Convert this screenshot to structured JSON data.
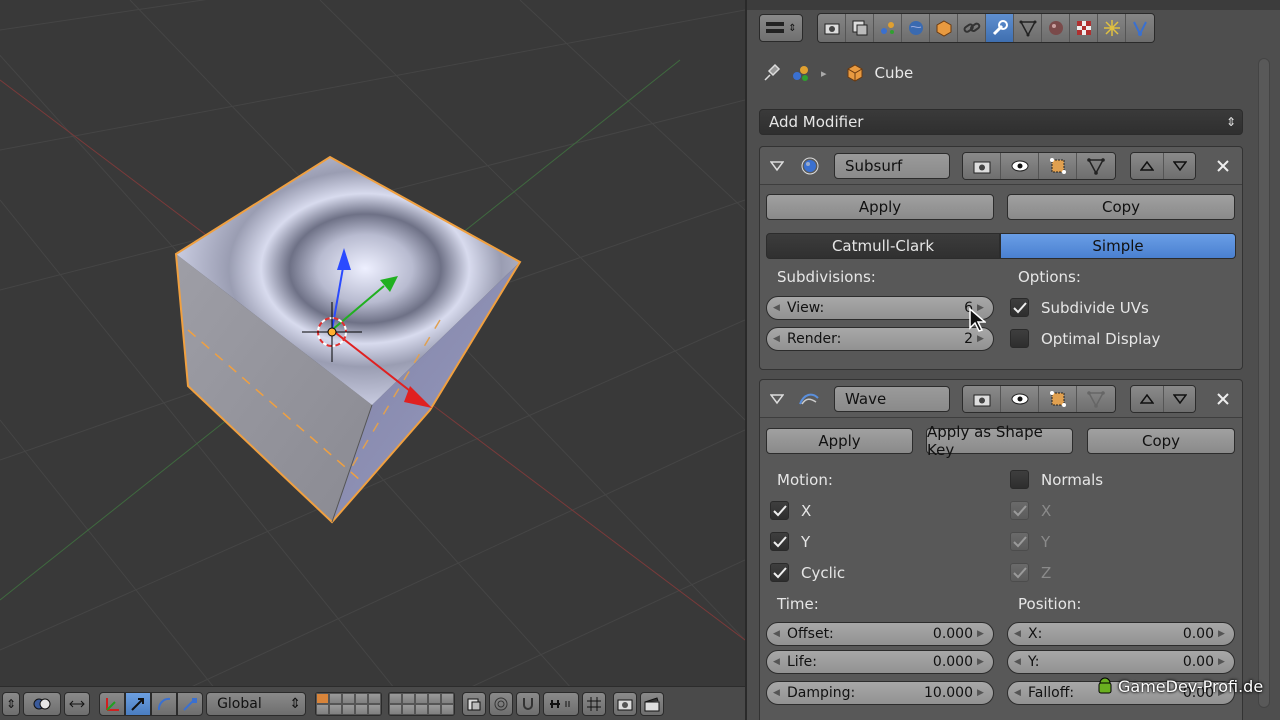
{
  "viewport": {
    "header": {
      "orientation": "Global"
    }
  },
  "properties": {
    "breadcrumb": {
      "object_name": "Cube"
    },
    "add_modifier_label": "Add Modifier",
    "subsurf": {
      "name": "Subsurf",
      "apply_label": "Apply",
      "copy_label": "Copy",
      "algorithm_options": [
        "Catmull-Clark",
        "Simple"
      ],
      "algorithm_selected": "Simple",
      "subdivisions_label": "Subdivisions:",
      "view_label": "View:",
      "view_value": "6",
      "render_label": "Render:",
      "render_value": "2",
      "options_label": "Options:",
      "subdivide_uvs_label": "Subdivide UVs",
      "subdivide_uvs_checked": true,
      "optimal_display_label": "Optimal Display",
      "optimal_display_checked": false
    },
    "wave": {
      "name": "Wave",
      "apply_label": "Apply",
      "apply_shape_label": "Apply as Shape Key",
      "copy_label": "Copy",
      "motion_label": "Motion:",
      "x_label": "X",
      "y_label": "Y",
      "cyclic_label": "Cyclic",
      "normals_label": "Normals",
      "nx_label": "X",
      "ny_label": "Y",
      "nz_label": "Z",
      "time_label": "Time:",
      "position_label": "Position:",
      "offset_label": "Offset:",
      "offset_value": "0.000",
      "life_label": "Life:",
      "life_value": "0.000",
      "damping_label": "Damping:",
      "damping_value": "10.000",
      "pos_x_label": "X:",
      "pos_x_value": "0.00",
      "pos_y_label": "Y:",
      "pos_y_value": "0.00",
      "falloff_label": "Falloff:",
      "falloff_value": "0.00"
    }
  },
  "watermark": "GameDev-Profi.de",
  "colors": {
    "accent_blue": "#5a8fdc",
    "selection_orange": "#f0a040",
    "viewport_bg": "#393939"
  }
}
